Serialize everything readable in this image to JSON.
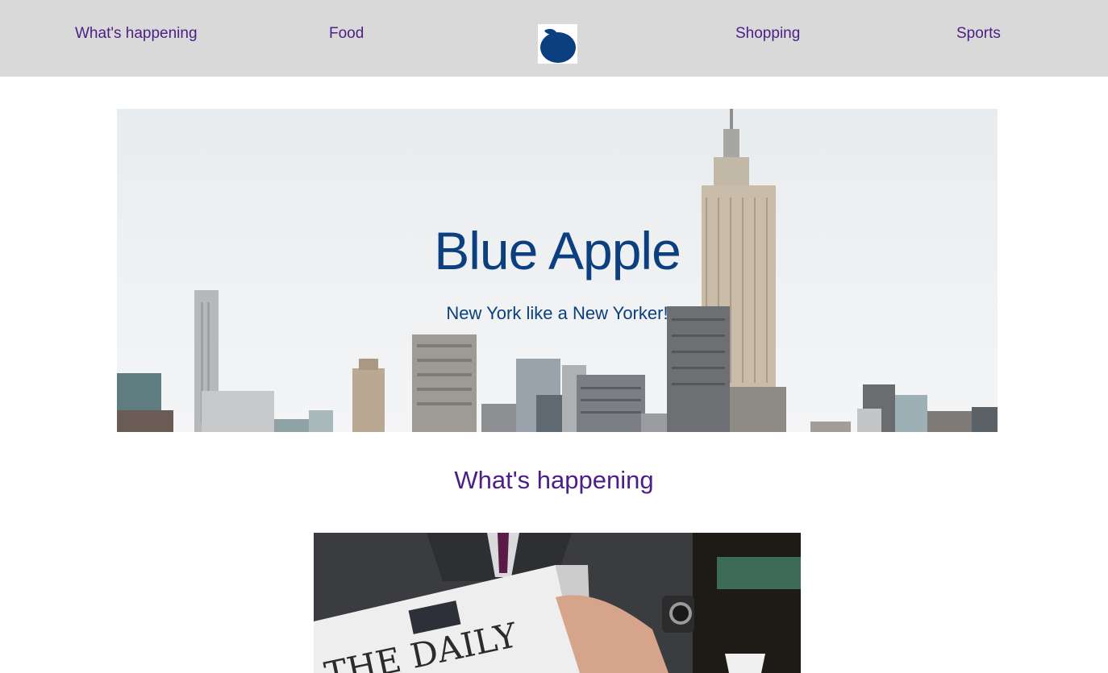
{
  "nav": {
    "items": [
      {
        "label": "What's happening"
      },
      {
        "label": "Food"
      },
      {
        "label": "Shopping"
      },
      {
        "label": "Sports"
      }
    ],
    "logo_icon": "blue-apple-icon"
  },
  "hero": {
    "title": "Blue Apple",
    "subtitle": "New York like a New Yorker!"
  },
  "section": {
    "title": "What's happening"
  },
  "newspaper": {
    "masthead": "THE DAILY"
  },
  "colors": {
    "nav_bg": "#d9d9d9",
    "nav_link": "#4b1f86",
    "brand_blue": "#0b3f7f",
    "section_title": "#4b1f86"
  }
}
